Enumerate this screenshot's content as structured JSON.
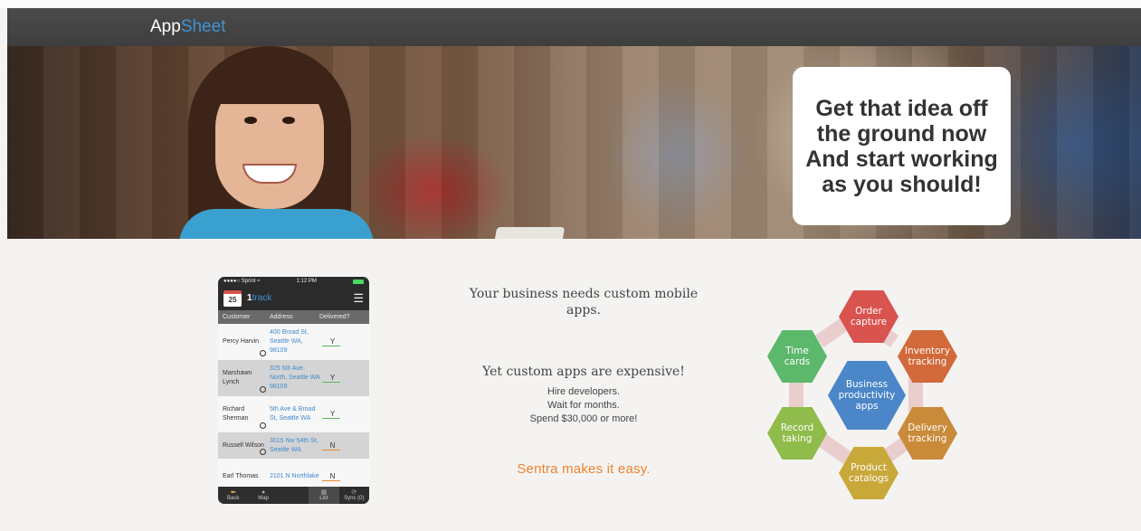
{
  "brand": {
    "prefix": "App",
    "suffix": "Sheet",
    "accent_color": "#3f93d6"
  },
  "hero": {
    "callout": "Get that idea off\nthe ground now\nAnd start working\nas you should!"
  },
  "phone": {
    "status": {
      "carrier": "●●●●○ Sprint",
      "wifi": "≈",
      "time": "1:12 PM"
    },
    "app": {
      "calendar_day": "25",
      "name_prefix": "1",
      "name_suffix": "track"
    },
    "columns": [
      "Customer",
      "Address",
      "Delivered?"
    ],
    "rows": [
      {
        "customer": "Percy Harvin",
        "address": "400 Broad St, Seattle WA, 98109",
        "delivered": "Y"
      },
      {
        "customer": "Marshawn Lynch",
        "address": "325 5th Ave. North, Seattle WA 98109",
        "delivered": "Y"
      },
      {
        "customer": "Richard Sherman",
        "address": "5th Ave & Broad St, Seattle WA",
        "delivered": "Y"
      },
      {
        "customer": "Russell Wilson",
        "address": "3015 Nw 54th St, Seattle WA",
        "delivered": "N"
      },
      {
        "customer": "Earl Thomas",
        "address": "2101 N Northlake",
        "delivered": "N"
      }
    ],
    "tabs": [
      {
        "label": "Back",
        "icon": "back-arrow-icon",
        "glyph": "⬅"
      },
      {
        "label": "Map",
        "icon": "globe-icon",
        "glyph": "●"
      },
      {
        "label": "",
        "icon": "",
        "glyph": ""
      },
      {
        "label": "List",
        "icon": "list-icon",
        "glyph": "▦"
      },
      {
        "label": "Sync (0)",
        "icon": "sync-icon",
        "glyph": "⟳"
      }
    ]
  },
  "marketing": {
    "headline": "Your business needs custom mobile apps.",
    "subheadline": "Yet custom apps are expensive!",
    "points": [
      "Hire developers.",
      "Wait for months.",
      "Spend $30,000 or more!"
    ],
    "cta": "Sentra makes it easy.",
    "cta_color": "#ee8330"
  },
  "diagram": {
    "center": {
      "label": "Business\nproductivity\napps",
      "color": "#4a86c8"
    },
    "nodes": [
      {
        "label": "Order\ncapture",
        "color": "#d9534f"
      },
      {
        "label": "Inventory\ntracking",
        "color": "#d2693a"
      },
      {
        "label": "Delivery\ntracking",
        "color": "#c98a3a"
      },
      {
        "label": "Product\ncatalogs",
        "color": "#c9a83a"
      },
      {
        "label": "Record\ntaking",
        "color": "#8fbc4a"
      },
      {
        "label": "Time\ncards",
        "color": "#5cb86b"
      }
    ]
  }
}
